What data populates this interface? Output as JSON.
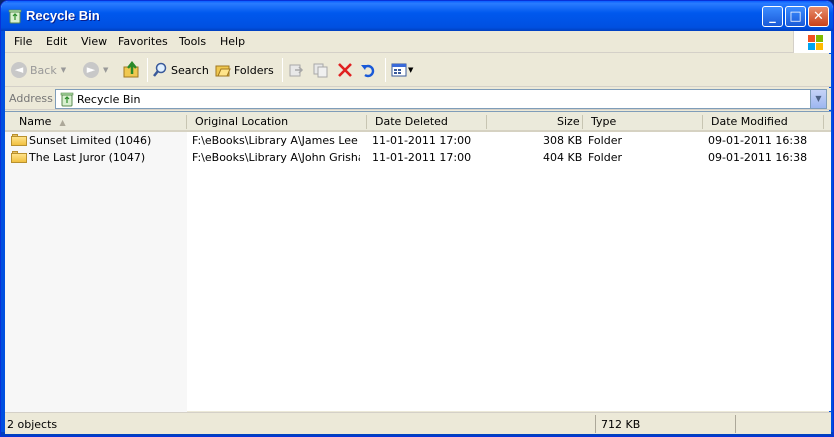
{
  "window": {
    "title": "Recycle Bin",
    "minimize": "_",
    "maximize": "□",
    "close": "✕"
  },
  "menu": [
    "File",
    "Edit",
    "View",
    "Favorites",
    "Tools",
    "Help"
  ],
  "toolbar": {
    "back": "Back",
    "search": "Search",
    "folders": "Folders"
  },
  "address": {
    "label": "Address",
    "value": "Recycle Bin"
  },
  "columns": [
    "Name",
    "Original Location",
    "Date Deleted",
    "Size",
    "Type",
    "Date Modified"
  ],
  "rows": [
    {
      "name": "Sunset Limited (1046)",
      "location": "F:\\eBooks\\Library A\\James Lee ...",
      "deleted": "11-01-2011 17:00",
      "size": "308 KB",
      "type": "Folder",
      "modified": "09-01-2011 16:38"
    },
    {
      "name": "The Last Juror (1047)",
      "location": "F:\\eBooks\\Library A\\John Grisham",
      "deleted": "11-01-2011 17:00",
      "size": "404 KB",
      "type": "Folder",
      "modified": "09-01-2011 16:38"
    }
  ],
  "status": {
    "objects": "2 objects",
    "size": "712 KB"
  },
  "colors": {
    "titlebar": "#0058ee",
    "accent_red": "#e02020",
    "undo_blue": "#1a5ad8"
  },
  "icons": [
    "recycle-bin-icon",
    "back-icon",
    "forward-icon",
    "up-folder-icon",
    "search-icon",
    "folders-icon",
    "move-to-icon",
    "copy-to-icon",
    "delete-icon",
    "undo-icon",
    "views-icon",
    "windows-logo-icon",
    "folder-icon"
  ]
}
